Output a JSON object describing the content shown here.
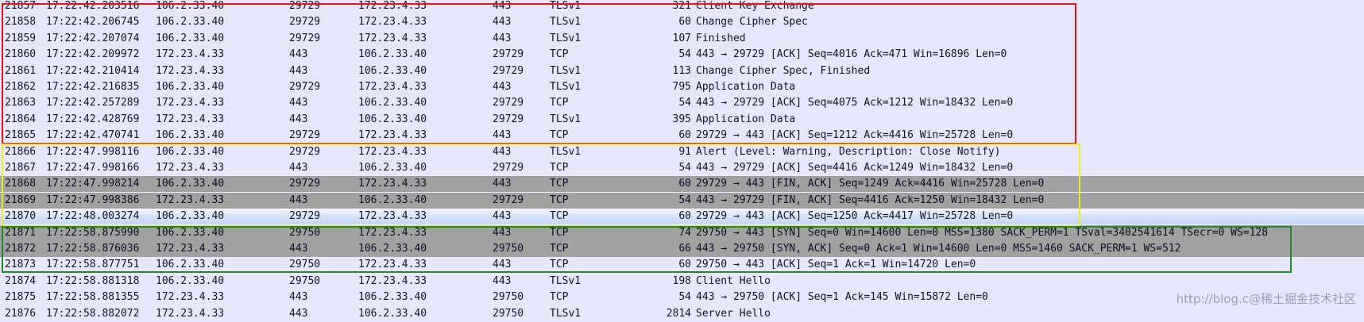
{
  "packets": [
    {
      "no": "21857",
      "time": "17:22:42.203516",
      "src": "106.2.33.40",
      "sport": "29729",
      "dst": "172.23.4.33",
      "dport": "443",
      "proto": "TLSv1",
      "len": "321",
      "info": "Client Key Exchange",
      "style": "normal"
    },
    {
      "no": "21858",
      "time": "17:22:42.206745",
      "src": "106.2.33.40",
      "sport": "29729",
      "dst": "172.23.4.33",
      "dport": "443",
      "proto": "TLSv1",
      "len": "60",
      "info": "Change Cipher Spec",
      "style": "normal"
    },
    {
      "no": "21859",
      "time": "17:22:42.207074",
      "src": "106.2.33.40",
      "sport": "29729",
      "dst": "172.23.4.33",
      "dport": "443",
      "proto": "TLSv1",
      "len": "107",
      "info": "Finished",
      "style": "normal"
    },
    {
      "no": "21860",
      "time": "17:22:42.209972",
      "src": "172.23.4.33",
      "sport": "443",
      "dst": "106.2.33.40",
      "dport": "29729",
      "proto": "TCP",
      "len": "54",
      "info": "443 → 29729 [ACK] Seq=4016 Ack=471 Win=16896 Len=0",
      "style": "normal"
    },
    {
      "no": "21861",
      "time": "17:22:42.210414",
      "src": "172.23.4.33",
      "sport": "443",
      "dst": "106.2.33.40",
      "dport": "29729",
      "proto": "TLSv1",
      "len": "113",
      "info": "Change Cipher Spec, Finished",
      "style": "normal"
    },
    {
      "no": "21862",
      "time": "17:22:42.216835",
      "src": "106.2.33.40",
      "sport": "29729",
      "dst": "172.23.4.33",
      "dport": "443",
      "proto": "TLSv1",
      "len": "795",
      "info": "Application Data",
      "style": "normal"
    },
    {
      "no": "21863",
      "time": "17:22:42.257289",
      "src": "172.23.4.33",
      "sport": "443",
      "dst": "106.2.33.40",
      "dport": "29729",
      "proto": "TCP",
      "len": "54",
      "info": "443 → 29729 [ACK] Seq=4075 Ack=1212 Win=18432 Len=0",
      "style": "normal"
    },
    {
      "no": "21864",
      "time": "17:22:42.428769",
      "src": "172.23.4.33",
      "sport": "443",
      "dst": "106.2.33.40",
      "dport": "29729",
      "proto": "TLSv1",
      "len": "395",
      "info": "Application Data",
      "style": "normal"
    },
    {
      "no": "21865",
      "time": "17:22:42.470741",
      "src": "106.2.33.40",
      "sport": "29729",
      "dst": "172.23.4.33",
      "dport": "443",
      "proto": "TCP",
      "len": "60",
      "info": "29729 → 443 [ACK] Seq=1212 Ack=4416 Win=25728 Len=0",
      "style": "normal"
    },
    {
      "no": "21866",
      "time": "17:22:47.998116",
      "src": "106.2.33.40",
      "sport": "29729",
      "dst": "172.23.4.33",
      "dport": "443",
      "proto": "TLSv1",
      "len": "91",
      "info": "Alert (Level: Warning, Description: Close Notify)",
      "style": "normal"
    },
    {
      "no": "21867",
      "time": "17:22:47.998166",
      "src": "172.23.4.33",
      "sport": "443",
      "dst": "106.2.33.40",
      "dport": "29729",
      "proto": "TCP",
      "len": "54",
      "info": "443 → 29729 [ACK] Seq=4416 Ack=1249 Win=18432 Len=0",
      "style": "normal"
    },
    {
      "no": "21868",
      "time": "17:22:47.998214",
      "src": "106.2.33.40",
      "sport": "29729",
      "dst": "172.23.4.33",
      "dport": "443",
      "proto": "TCP",
      "len": "60",
      "info": "29729 → 443 [FIN, ACK] Seq=1249 Ack=4416 Win=25728 Len=0",
      "style": "gray"
    },
    {
      "no": "21869",
      "time": "17:22:47.998386",
      "src": "172.23.4.33",
      "sport": "443",
      "dst": "106.2.33.40",
      "dport": "29729",
      "proto": "TCP",
      "len": "54",
      "info": "443 → 29729 [FIN, ACK] Seq=4416 Ack=1250 Win=18432 Len=0",
      "style": "gray"
    },
    {
      "no": "21870",
      "time": "17:22:48.003274",
      "src": "106.2.33.40",
      "sport": "29729",
      "dst": "172.23.4.33",
      "dport": "443",
      "proto": "TCP",
      "len": "60",
      "info": "29729 → 443 [ACK] Seq=1250 Ack=4417 Win=25728 Len=0",
      "style": "selected"
    },
    {
      "no": "21871",
      "time": "17:22:58.875990",
      "src": "106.2.33.40",
      "sport": "29750",
      "dst": "172.23.4.33",
      "dport": "443",
      "proto": "TCP",
      "len": "74",
      "info": "29750 → 443 [SYN] Seq=0 Win=14600 Len=0 MSS=1380 SACK_PERM=1 TSval=3402541614 TSecr=0 WS=128",
      "style": "gray"
    },
    {
      "no": "21872",
      "time": "17:22:58.876036",
      "src": "172.23.4.33",
      "sport": "443",
      "dst": "106.2.33.40",
      "dport": "29750",
      "proto": "TCP",
      "len": "66",
      "info": "443 → 29750 [SYN, ACK] Seq=0 Ack=1 Win=14600 Len=0 MSS=1460 SACK_PERM=1 WS=512",
      "style": "gray"
    },
    {
      "no": "21873",
      "time": "17:22:58.877751",
      "src": "106.2.33.40",
      "sport": "29750",
      "dst": "172.23.4.33",
      "dport": "443",
      "proto": "TCP",
      "len": "60",
      "info": "29750 → 443 [ACK] Seq=1 Ack=1 Win=14720 Len=0",
      "style": "normal"
    },
    {
      "no": "21874",
      "time": "17:22:58.881318",
      "src": "106.2.33.40",
      "sport": "29750",
      "dst": "172.23.4.33",
      "dport": "443",
      "proto": "TLSv1",
      "len": "198",
      "info": "Client Hello",
      "style": "normal"
    },
    {
      "no": "21875",
      "time": "17:22:58.881355",
      "src": "172.23.4.33",
      "sport": "443",
      "dst": "106.2.33.40",
      "dport": "29750",
      "proto": "TCP",
      "len": "54",
      "info": "443 → 29750 [ACK] Seq=1 Ack=145 Win=15872 Len=0",
      "style": "normal"
    },
    {
      "no": "21876",
      "time": "17:22:58.882072",
      "src": "172.23.4.33",
      "sport": "443",
      "dst": "106.2.33.40",
      "dport": "29750",
      "proto": "TLSv1",
      "len": "2814",
      "info": "Server Hello",
      "style": "normal"
    }
  ],
  "colors": {
    "row_normal": "#e7e6fb",
    "row_gray": "#a1a1a1",
    "row_selected": "#d2e2f9",
    "box_red": "#e3151c",
    "box_yellow": "#eaec2a",
    "box_green": "#1f8a2c"
  },
  "watermark": {
    "text": "http://blog.c@稀土掘金技术社区"
  }
}
